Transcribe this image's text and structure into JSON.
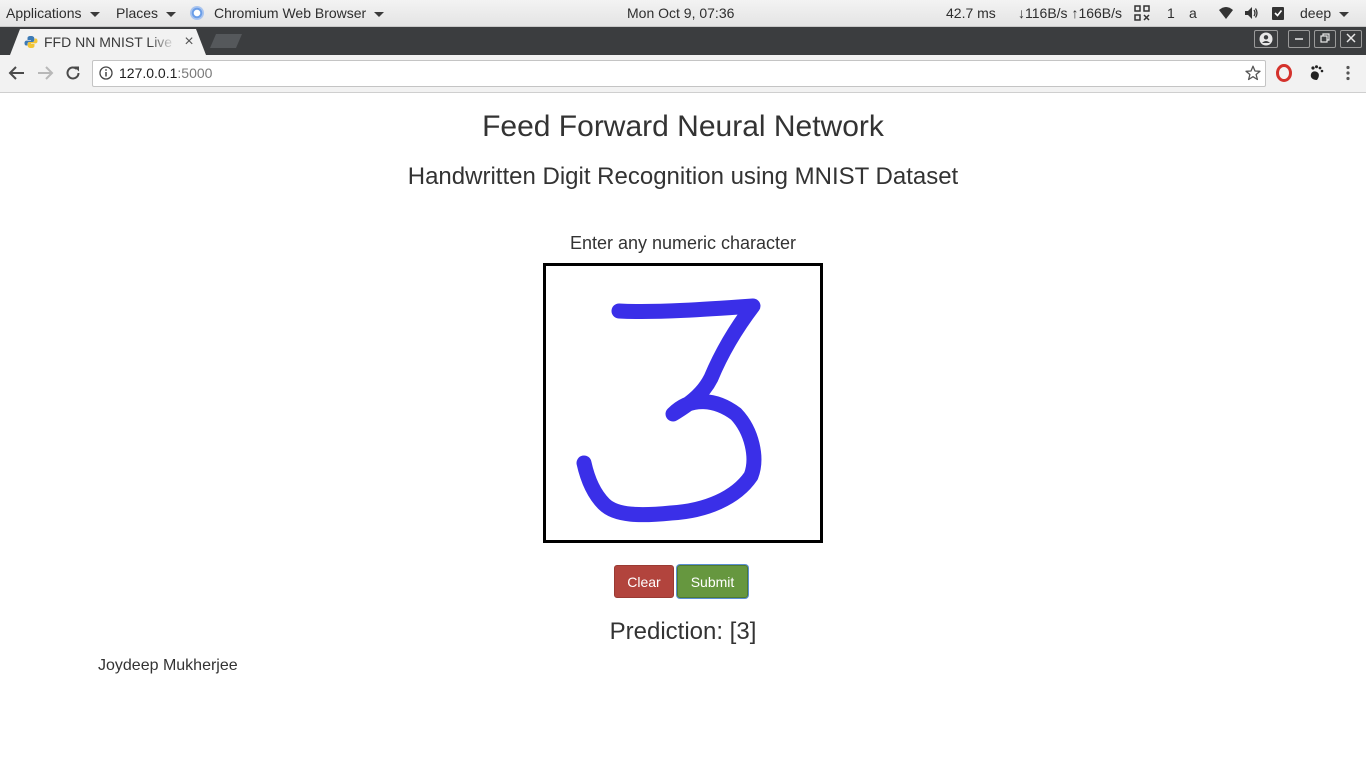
{
  "panel": {
    "applications_label": "Applications",
    "places_label": "Places",
    "active_app_label": "Chromium Web Browser",
    "clock": "Mon Oct  9, 07:36",
    "latency": "42.7 ms",
    "net_down": "↓116B/s",
    "net_up": "↑166B/s",
    "workspace": "1",
    "keyboard_layout": "a",
    "user": "deep"
  },
  "browser": {
    "tab_title": "FFD NN MNIST Live",
    "tab_close": "×",
    "url_host": "127.0.0.1",
    "url_port": ":5000"
  },
  "page": {
    "title": "Feed Forward Neural Network",
    "subtitle": "Handwritten Digit Recognition using MNIST Dataset",
    "prompt": "Enter any numeric character",
    "clear_label": "Clear",
    "submit_label": "Submit",
    "prediction": "Prediction: [3]",
    "author": "Joydeep Mukherjee"
  },
  "drawing": {
    "digit": "3",
    "stroke_color": "#3a2fe8"
  },
  "colors": {
    "clear_button": "#b2443d",
    "submit_button": "#66973f"
  }
}
